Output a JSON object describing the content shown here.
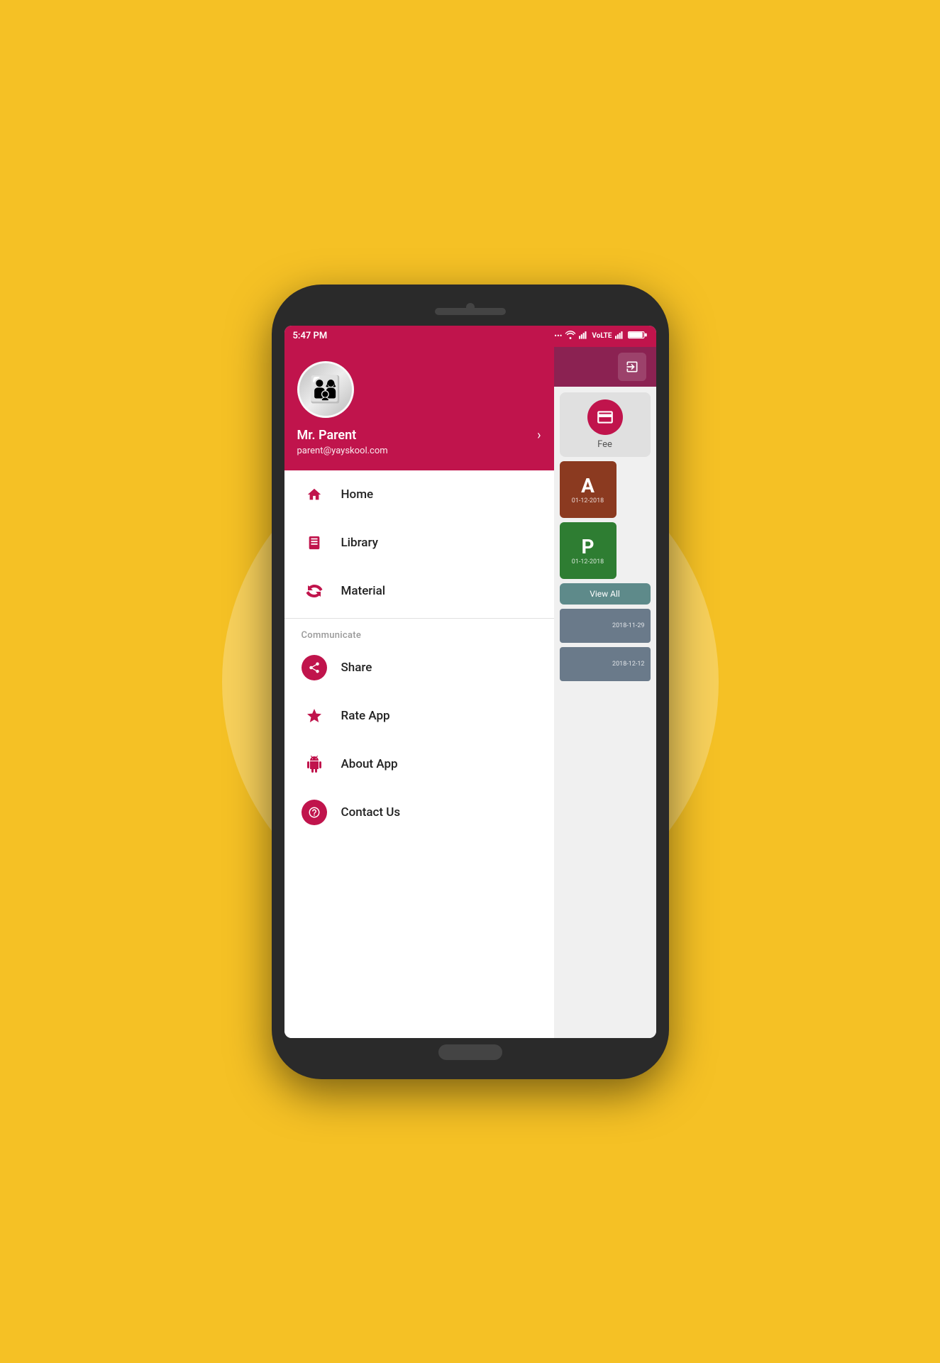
{
  "background_color": "#F5C125",
  "status_bar": {
    "time": "5:47 PM",
    "icons": "... ⓦ ▶▶ VoLTE ▶▶ 🔋"
  },
  "drawer_header": {
    "user_name": "Mr. Parent",
    "user_email": "parent@yayskool.com"
  },
  "menu_items": [
    {
      "id": "home",
      "label": "Home",
      "icon_type": "house"
    },
    {
      "id": "library",
      "label": "Library",
      "icon_type": "book"
    },
    {
      "id": "material",
      "label": "Material",
      "icon_type": "reading"
    }
  ],
  "communicate_section": {
    "title": "Communicate",
    "items": [
      {
        "id": "share",
        "label": "Share",
        "icon_type": "share"
      },
      {
        "id": "rate_app",
        "label": "Rate App",
        "icon_type": "star"
      },
      {
        "id": "about_app",
        "label": "About App",
        "icon_type": "android"
      },
      {
        "id": "contact_us",
        "label": "Contact Us",
        "icon_type": "question"
      }
    ]
  },
  "right_panel": {
    "fee_label": "Fee",
    "grade_a": {
      "letter": "A",
      "date": "01-12-2018"
    },
    "grade_p": {
      "letter": "P",
      "date": "01-12-2018"
    },
    "view_all": "View All",
    "list_date1": "2018-11-29",
    "list_date2": "2018-12-12"
  },
  "accent_color": "#c0144c"
}
